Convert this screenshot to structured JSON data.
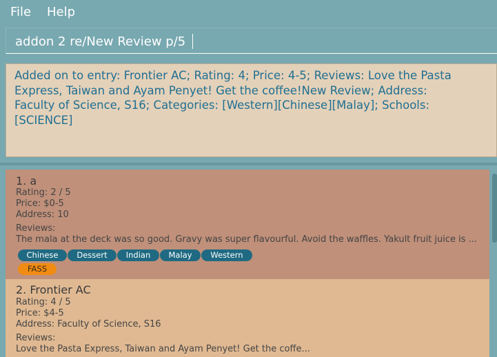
{
  "menu": {
    "file": "File",
    "help": "Help"
  },
  "command": {
    "text": "addon 2 re/New Review p/5"
  },
  "result": {
    "line1": "Added on to entry: Frontier AC; Rating: 4; Price: 4-5; Reviews: Love the Pasta",
    "line2": "Express, Taiwan and Ayam Penyet! Get the coffee!New Review; Address:",
    "line3": "Faculty of Science, S16; Categories: [Western][Chinese][Malay]; Schools:",
    "line4": "[SCIENCE]"
  },
  "entries": [
    {
      "title": "1.  a",
      "rating": "Rating: 2 / 5",
      "price": "Price: $0-5",
      "address": "Address: 10",
      "reviews_label": "Reviews:",
      "reviews": "The mala at the deck was so good. Gravy was super flavourful. Avoid the waffles.  Yakult fruit juice is ...",
      "categories": [
        "Chinese",
        "Dessert",
        "Indian",
        "Malay",
        "Western"
      ],
      "schools": [
        "FASS"
      ]
    },
    {
      "title": "2.  Frontier AC",
      "rating": "Rating: 4 / 5",
      "price": "Price: $4-5",
      "address": "Address: Faculty of Science, S16",
      "reviews_label": "Reviews:",
      "reviews": "Love the Pasta Express, Taiwan and Ayam Penyet! Get the coffe..."
    }
  ],
  "colors": {
    "background": "#78a8b0",
    "result_bg": "#e4d1b9",
    "result_text": "#1f6f92",
    "card_selected": "#c0907a",
    "card_normal": "#e0b992",
    "category_tag": "#1f6a82",
    "school_tag": "#f08c14"
  }
}
